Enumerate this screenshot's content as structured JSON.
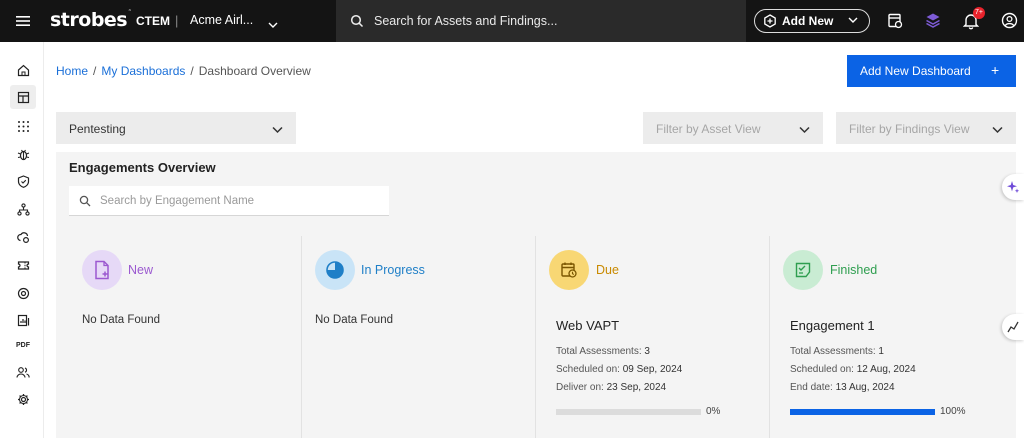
{
  "topbar": {
    "logo": "strobes",
    "logo_mark": "˜",
    "product": "CTEM",
    "separator": "|",
    "org": "Acme Airl...",
    "search_placeholder": "Search for Assets and Findings...",
    "add_new_label": "Add New",
    "notification_count": "7+"
  },
  "breadcrumb": {
    "home": "Home",
    "sep": "/",
    "dashboards": "My Dashboards",
    "current": "Dashboard Overview"
  },
  "actions": {
    "add_dashboard_label": "Add New Dashboard",
    "add_dashboard_plus": "+"
  },
  "filters": {
    "dashboard_select": "Pentesting",
    "asset_view_placeholder": "Filter by Asset View",
    "findings_view_placeholder": "Filter by Findings View"
  },
  "engagements": {
    "title": "Engagements Overview",
    "search_placeholder": "Search by Engagement Name",
    "columns": [
      {
        "label": "New",
        "empty_text": "No Data Found",
        "color": "#9b59d0",
        "bg": "#e6d9f7"
      },
      {
        "label": "In Progress",
        "empty_text": "No Data Found",
        "color": "#1f7fc7",
        "bg": "#c9e4f7"
      },
      {
        "label": "Due",
        "color": "#c98a00",
        "bg": "#f8d774",
        "card": {
          "name": "Web VAPT",
          "line1_label": "Total Assessments:",
          "line1_value": "3",
          "line2_label": "Scheduled on:",
          "line2_value": "09 Sep, 2024",
          "line3_label": "Deliver on:",
          "line3_value": "23 Sep, 2024",
          "progress": 0,
          "progress_label": "0%"
        }
      },
      {
        "label": "Finished",
        "color": "#2e9e4f",
        "bg": "#c9ecd3",
        "card": {
          "name": "Engagement 1",
          "line1_label": "Total Assessments:",
          "line1_value": "1",
          "line2_label": "Scheduled on:",
          "line2_value": "12 Aug, 2024",
          "line3_label": "End date:",
          "line3_value": "13 Aug, 2024",
          "progress": 100,
          "progress_label": "100%"
        }
      }
    ]
  }
}
